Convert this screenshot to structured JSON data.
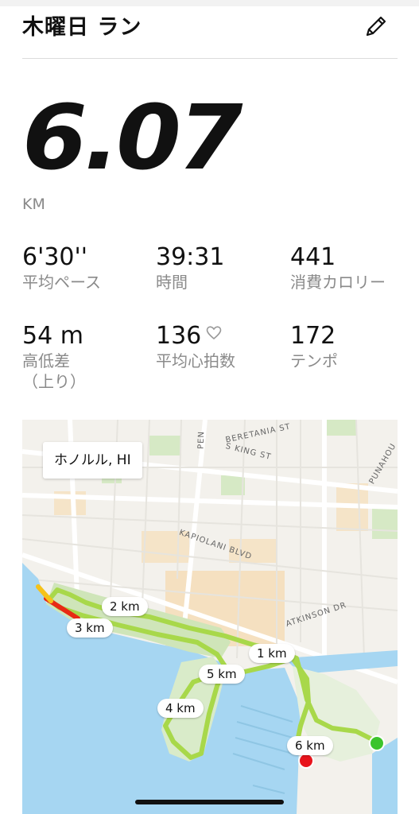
{
  "header": {
    "title": "木曜日 ラン",
    "edit_icon": "pencil-icon"
  },
  "distance": {
    "value": "6.07",
    "unit": "KM"
  },
  "stats": [
    {
      "value": "6'30''",
      "label": "平均ペース"
    },
    {
      "value": "39:31",
      "label": "時間"
    },
    {
      "value": "441",
      "label": "消費カロリー"
    },
    {
      "value": "54 m",
      "label": "高低差\n（上り）"
    },
    {
      "value": "136",
      "label": "平均心拍数",
      "icon": "heart-outline-icon"
    },
    {
      "value": "172",
      "label": "テンポ"
    }
  ],
  "map": {
    "location": "ホノルル, HI",
    "streets": [
      "BERETANIA ST",
      "S KING ST",
      "KAPIOLANI BLVD",
      "ATKINSON DR",
      "PUNAHOU",
      "PEN"
    ],
    "km_markers": [
      "2 km",
      "3 km",
      "1 km",
      "5 km",
      "4 km",
      "6 km"
    ],
    "colors": {
      "water": "#a6d6f2",
      "land": "#f3f1ec",
      "park": "#cfe5b9",
      "route": "#a8d84a",
      "start": "#3cc42c",
      "end": "#e8141c"
    }
  }
}
